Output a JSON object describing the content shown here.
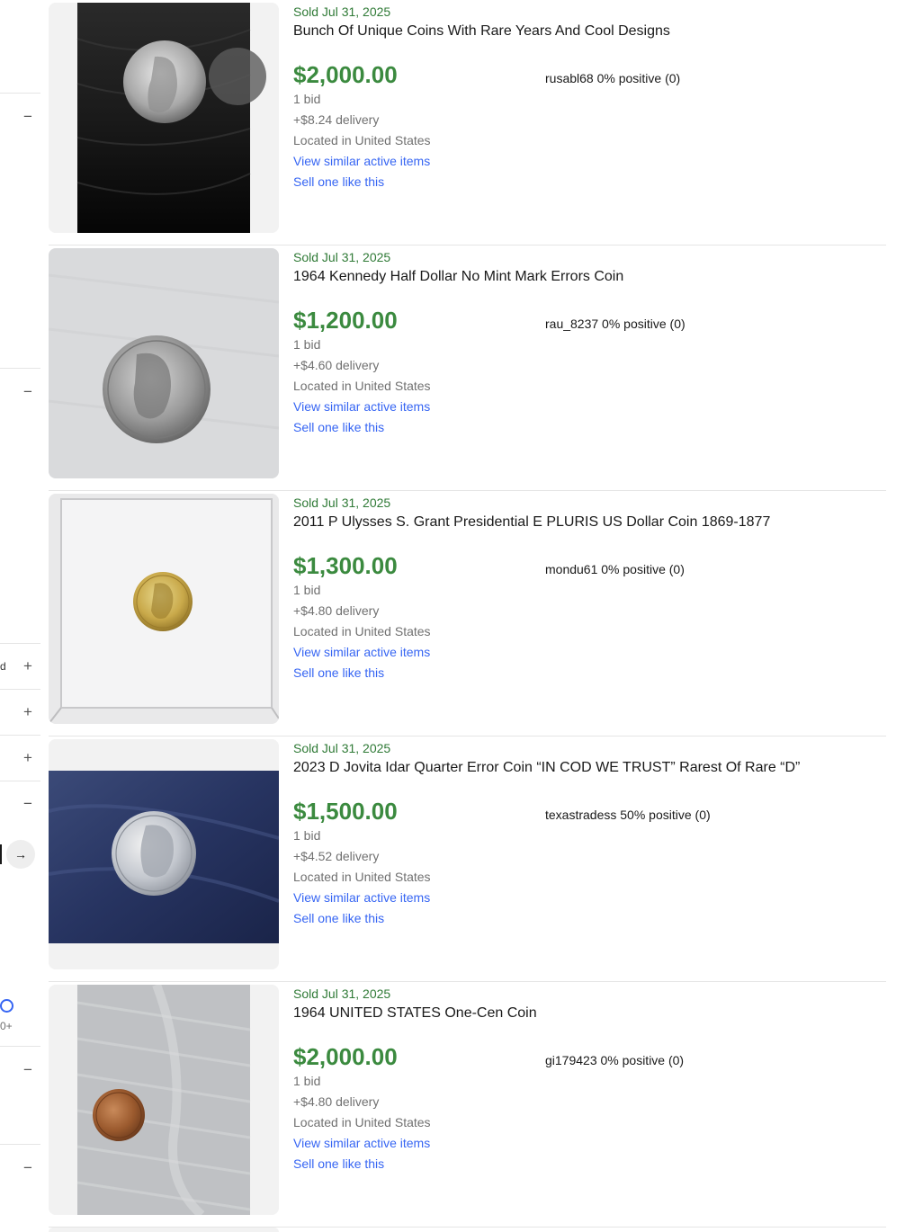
{
  "sidebar": {
    "toggles": [
      "−",
      "−",
      "+",
      "+",
      "+",
      "−",
      "−",
      "−"
    ],
    "cut_label": "d",
    "radio_caption": "0+",
    "go_arrow": "→"
  },
  "listings": [
    {
      "sold": "Sold Jul 31, 2025",
      "title": "Bunch Of Unique Coins With Rare Years And Cool Designs",
      "price": "$2,000.00",
      "seller": "rusabl68 0% positive (0)",
      "bids": "1 bid",
      "delivery": "+$8.24 delivery",
      "location": "Located in United States",
      "similar": "View similar active items",
      "sell": "Sell one like this"
    },
    {
      "sold": "Sold Jul 31, 2025",
      "title": "1964 Kennedy Half Dollar No Mint Mark Errors Coin",
      "price": "$1,200.00",
      "seller": "rau_8237 0% positive (0)",
      "bids": "1 bid",
      "delivery": "+$4.60 delivery",
      "location": "Located in United States",
      "similar": "View similar active items",
      "sell": "Sell one like this"
    },
    {
      "sold": "Sold Jul 31, 2025",
      "title": "2011 P Ulysses S. Grant Presidential E PLURIS US Dollar Coin 1869-1877",
      "price": "$1,300.00",
      "seller": "mondu61 0% positive (0)",
      "bids": "1 bid",
      "delivery": "+$4.80 delivery",
      "location": "Located in United States",
      "similar": "View similar active items",
      "sell": "Sell one like this"
    },
    {
      "sold": "Sold Jul 31, 2025",
      "title": "2023 D Jovita Idar Quarter Error Coin “IN COD WE TRUST” Rarest Of Rare “D”",
      "price": "$1,500.00",
      "seller": "texastradess 50% positive (0)",
      "bids": "1 bid",
      "delivery": "+$4.52 delivery",
      "location": "Located in United States",
      "similar": "View similar active items",
      "sell": "Sell one like this"
    },
    {
      "sold": "Sold Jul 31, 2025",
      "title": "1964 UNITED STATES One-Cen Coin",
      "price": "$2,000.00",
      "seller": "gi179423 0% positive (0)",
      "bids": "1 bid",
      "delivery": "+$4.80 delivery",
      "location": "Located in United States",
      "similar": "View similar active items",
      "sell": "Sell one like this"
    }
  ],
  "colors": {
    "sold_green": "#2f7a36",
    "price_green": "#3b8a3f",
    "link_blue": "#3665f3",
    "muted_gray": "#707070"
  }
}
